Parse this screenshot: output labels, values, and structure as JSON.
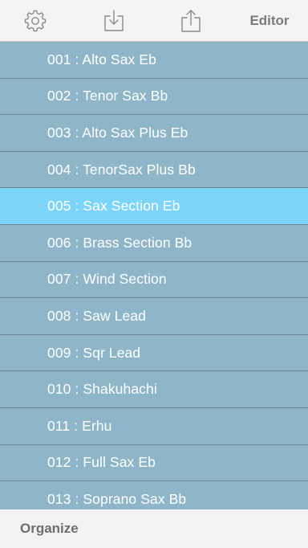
{
  "toolbar": {
    "settings_icon": "gear-icon",
    "import_icon": "download-tray-icon",
    "share_icon": "share-icon",
    "editor_label": "Editor",
    "icon_color": "#8a8a8a"
  },
  "voices": {
    "selected_index": 4,
    "items": [
      {
        "label": "001 : Alto Sax Eb"
      },
      {
        "label": "002 : Tenor Sax Bb"
      },
      {
        "label": "003 : Alto Sax Plus Eb"
      },
      {
        "label": "004 : TenorSax Plus Bb"
      },
      {
        "label": "005 : Sax Section Eb"
      },
      {
        "label": "006 : Brass Section Bb"
      },
      {
        "label": "007 : Wind Section"
      },
      {
        "label": "008 : Saw Lead"
      },
      {
        "label": "009 : Sqr Lead"
      },
      {
        "label": "010 : Shakuhachi"
      },
      {
        "label": "011 : Erhu"
      },
      {
        "label": "012 : Full Sax Eb"
      },
      {
        "label": "013 : Soprano Sax Bb"
      }
    ]
  },
  "bottom": {
    "organize_label": "Organize"
  },
  "colors": {
    "row_bg": "#8fb5c9",
    "row_selected_bg": "#7dd4fb",
    "row_text": "#ffffff"
  }
}
